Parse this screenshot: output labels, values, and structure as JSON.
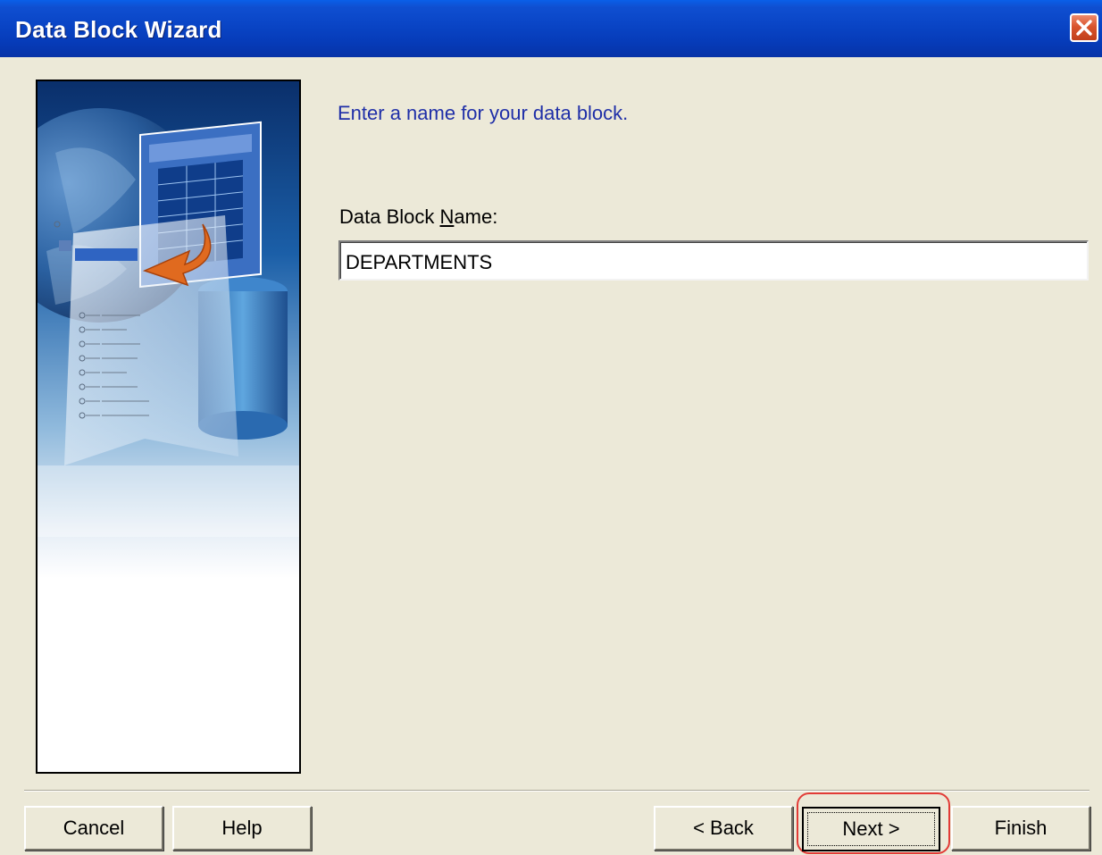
{
  "window": {
    "title": "Data Block Wizard",
    "close_icon": "close-icon"
  },
  "banner": {
    "icon": "wizard-illustration",
    "colors": {
      "sky": "#0b3b82",
      "arrow": "#e06a1f"
    }
  },
  "main": {
    "prompt": "Enter a name for your data block.",
    "field_label_pre": "Data Block ",
    "field_label_accel": "N",
    "field_label_post": "ame:",
    "field_value": "DEPARTMENTS"
  },
  "buttons": {
    "cancel": "Cancel",
    "help": "Help",
    "back": "< Back",
    "next": "Next >",
    "finish": "Finish"
  },
  "colors": {
    "titlebar": "#0a46c7",
    "dialog_bg": "#ece9d8",
    "prompt_text": "#1f2fa8",
    "highlight": "#e23b36"
  }
}
